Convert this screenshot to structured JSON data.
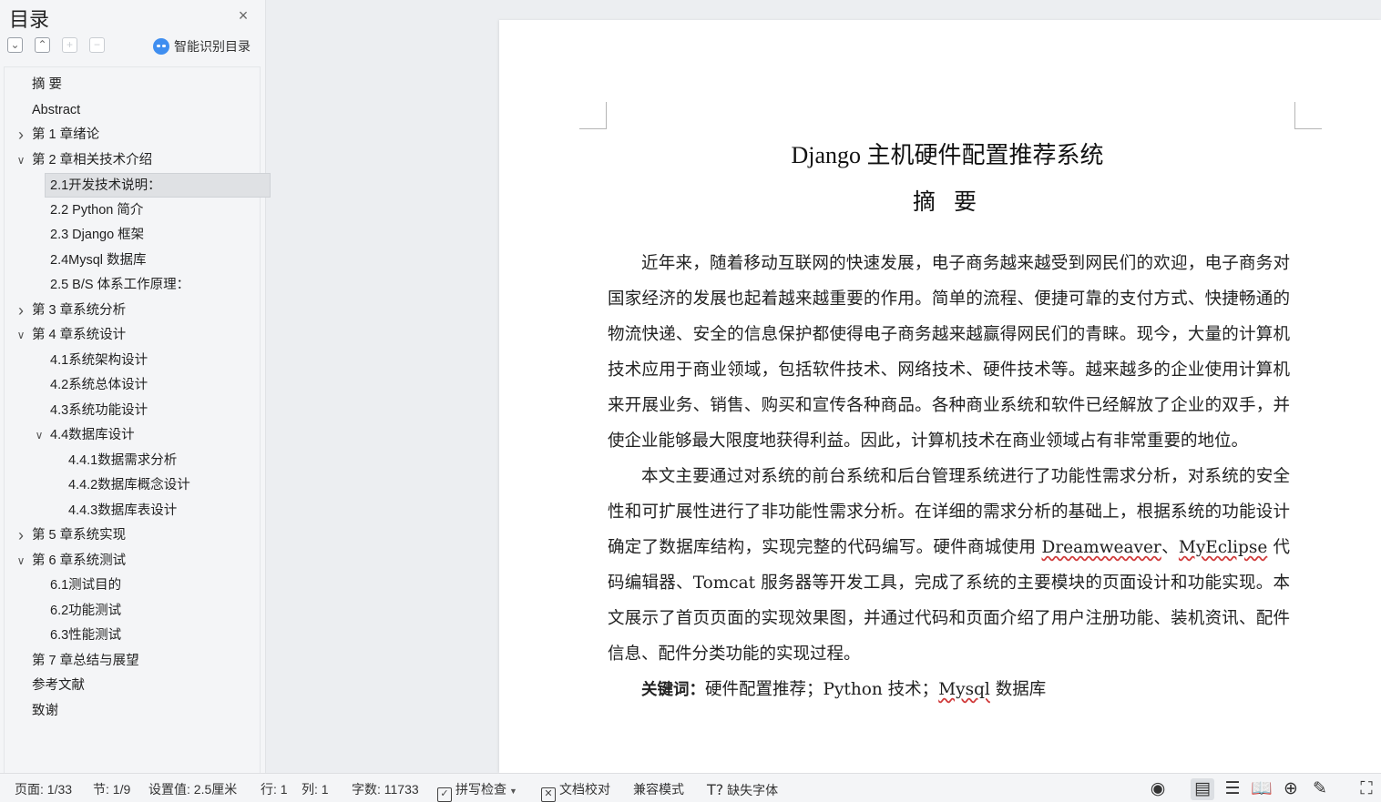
{
  "sidebar": {
    "title": "目录",
    "close_icon": "×",
    "tools": [
      "collapse-all",
      "expand-all",
      "add",
      "remove"
    ],
    "smart_toc_label": "智能识别目录"
  },
  "toc": [
    {
      "label": "摘  要",
      "level": 0,
      "chevron": ""
    },
    {
      "label": "Abstract",
      "level": 0,
      "chevron": ""
    },
    {
      "label": "第 1 章绪论",
      "level": 0,
      "chevron": "right"
    },
    {
      "label": "第 2 章相关技术介绍",
      "level": 0,
      "chevron": "down"
    },
    {
      "label": "2.1开发技术说明：",
      "level": 1,
      "chevron": "",
      "selected": true
    },
    {
      "label": "2.2  Python 简介",
      "level": 1,
      "chevron": ""
    },
    {
      "label": "2.3  Django 框架",
      "level": 1,
      "chevron": ""
    },
    {
      "label": "2.4Mysql 数据库",
      "level": 1,
      "chevron": ""
    },
    {
      "label": "2.5  B/S 体系工作原理：",
      "level": 1,
      "chevron": ""
    },
    {
      "label": "第 3 章系统分析",
      "level": 0,
      "chevron": "right"
    },
    {
      "label": "第 4 章系统设计",
      "level": 0,
      "chevron": "down"
    },
    {
      "label": "4.1系统架构设计",
      "level": 1,
      "chevron": ""
    },
    {
      "label": "4.2系统总体设计",
      "level": 1,
      "chevron": ""
    },
    {
      "label": "4.3系统功能设计",
      "level": 1,
      "chevron": ""
    },
    {
      "label": "4.4数据库设计",
      "level": 1,
      "chevron": "down"
    },
    {
      "label": "4.4.1数据需求分析",
      "level": 2,
      "chevron": ""
    },
    {
      "label": "4.4.2数据库概念设计",
      "level": 2,
      "chevron": ""
    },
    {
      "label": "4.4.3数据库表设计",
      "level": 2,
      "chevron": ""
    },
    {
      "label": "第 5 章系统实现",
      "level": 0,
      "chevron": "right"
    },
    {
      "label": "第 6 章系统测试",
      "level": 0,
      "chevron": "down"
    },
    {
      "label": "6.1测试目的",
      "level": 1,
      "chevron": ""
    },
    {
      "label": "6.2功能测试",
      "level": 1,
      "chevron": ""
    },
    {
      "label": "6.3性能测试",
      "level": 1,
      "chevron": ""
    },
    {
      "label": "第 7 章总结与展望",
      "level": 0,
      "chevron": ""
    },
    {
      "label": "参考文献",
      "level": 0,
      "chevron": ""
    },
    {
      "label": "致谢",
      "level": 0,
      "chevron": ""
    }
  ],
  "document": {
    "title": "Django  主机硬件配置推荐系统",
    "subtitle": "摘 要",
    "para1": "近年来，随着移动互联网的快速发展，电子商务越来越受到网民们的欢迎，电子商务对国家经济的发展也起着越来越重要的作用。简单的流程、便捷可靠的支付方式、快捷畅通的物流快递、安全的信息保护都使得电子商务越来越赢得网民们的青睐。现今，大量的计算机技术应用于商业领域，包括软件技术、网络技术、硬件技术等。越来越多的企业使用计算机来开展业务、销售、购买和宣传各种商品。各种商业系统和软件已经解放了企业的双手，并使企业能够最大限度地获得利益。因此，计算机技术在商业领域占有非常重要的地位。",
    "para2_a": "本文主要通过对系统的前台系统和后台管理系统进行了功能性需求分析，对系统的安全性和可扩展性进行了非功能性需求分析。在详细的需求分析的基础上，根据系统的功能设计确定了数据库结构，实现完整的代码编写。硬件商城使用 ",
    "para2_dreamweaver": "Dreamweaver",
    "para2_b": "、",
    "para2_myeclipse": "MyEclipse",
    "para2_c": " 代码编辑器、Tomcat 服务器等开发工具，完成了系统的主要模块的页面设计和功能实现。本文展示了首页页面的实现效果图，并通过代码和页面介绍了用户注册功能、装机资讯、配件信息、配件分类功能的实现过程。",
    "keywords_label": "关键词：",
    "keywords_a": "硬件配置推荐；Python 技术；",
    "keywords_mysql": "Mysql",
    "keywords_b": " 数据库"
  },
  "statusbar": {
    "page": "页面: 1/33",
    "section": "节: 1/9",
    "setting": "设置值: 2.5厘米",
    "row": "行: 1",
    "col": "列: 1",
    "wordcount": "字数: 11733",
    "spellcheck": "拼写检查",
    "proofread": "文档校对",
    "compat": "兼容模式",
    "missing_font": "缺失字体"
  }
}
